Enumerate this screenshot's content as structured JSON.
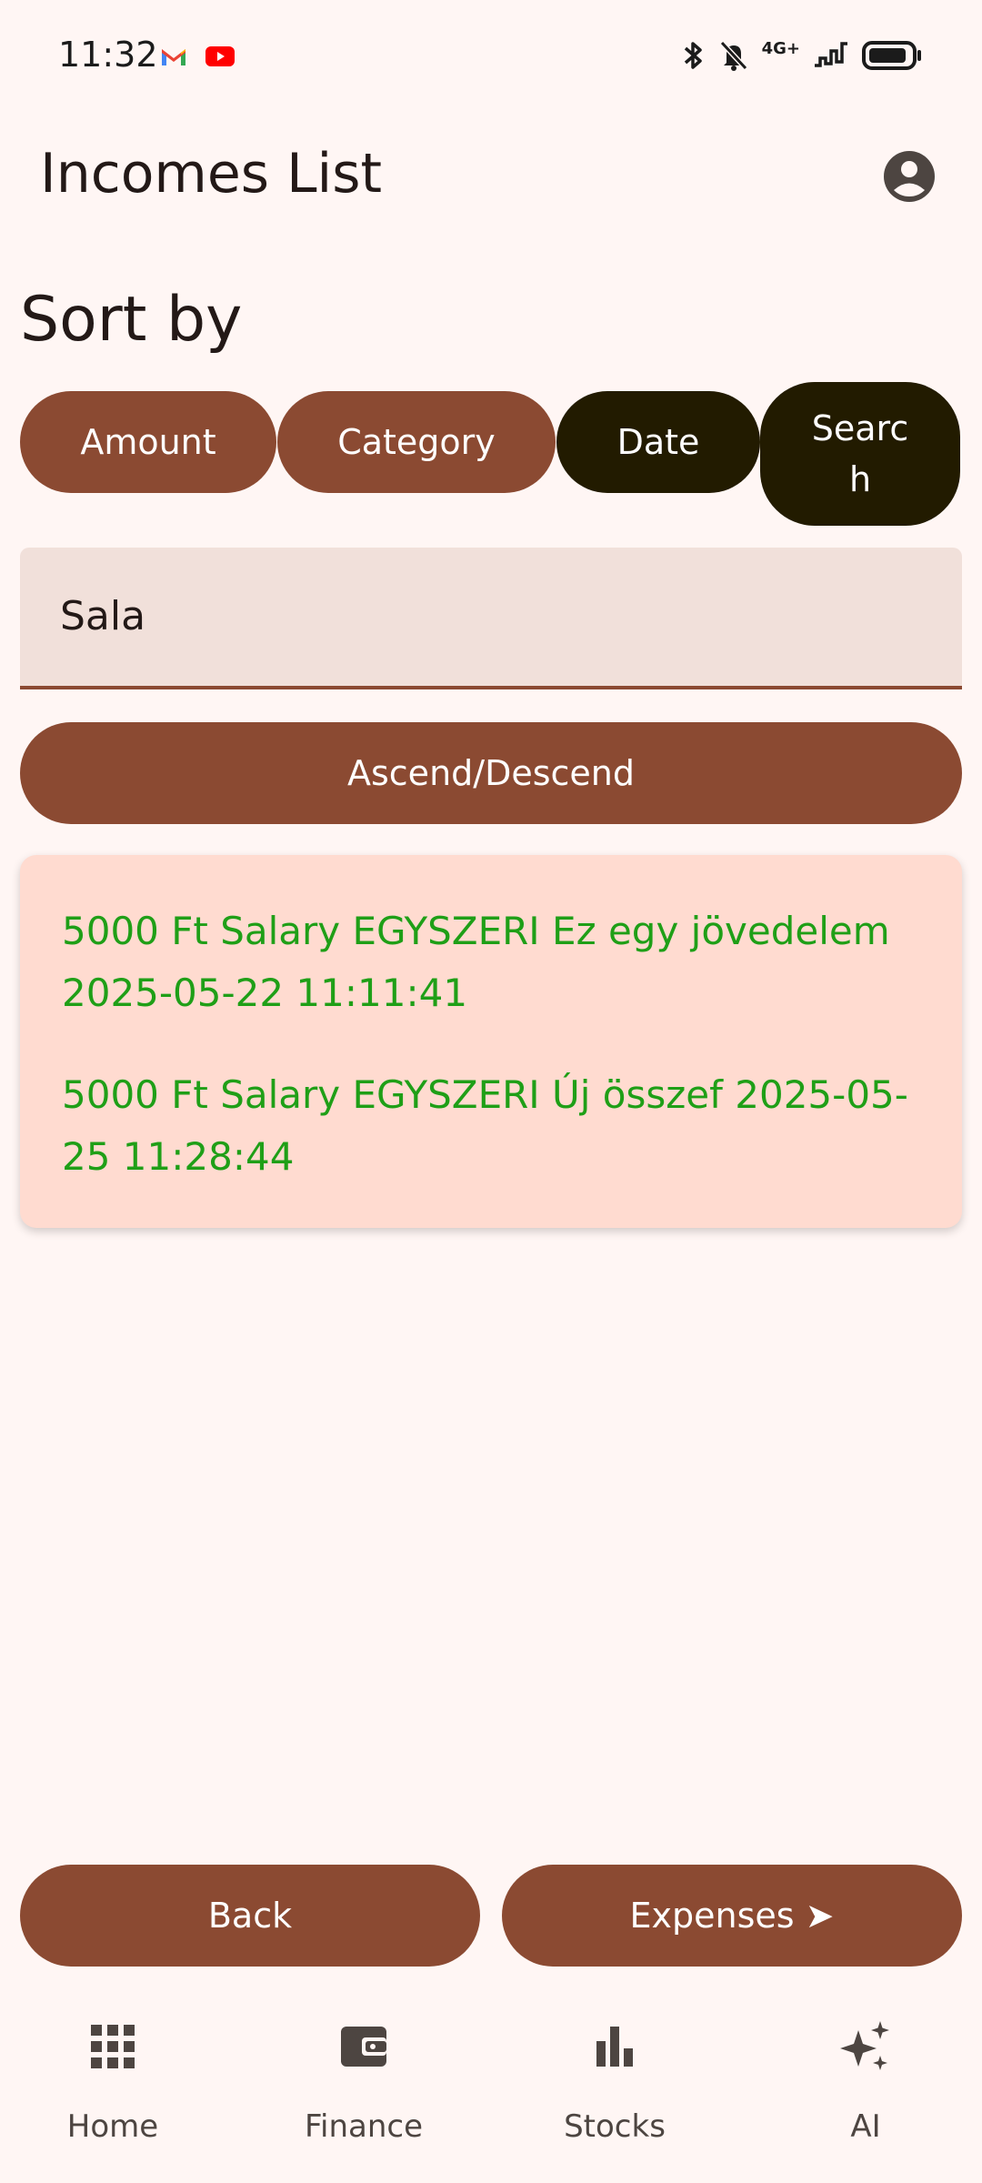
{
  "status_bar": {
    "time": "11:32",
    "notifications": [
      "gmail-icon",
      "youtube-icon"
    ],
    "network": "4G+",
    "system_icons": [
      "bluetooth-icon",
      "mute-icon",
      "signal-icon",
      "battery-icon"
    ]
  },
  "app_bar": {
    "title": "Incomes List",
    "account_icon": "account-circle-icon"
  },
  "sort": {
    "title": "Sort by",
    "options": [
      {
        "label": "Amount",
        "selected": false
      },
      {
        "label": "Category",
        "selected": false
      },
      {
        "label": "Date",
        "selected": true
      },
      {
        "label": "Search",
        "selected": true
      }
    ]
  },
  "search": {
    "value": "Sala"
  },
  "order_button": "Ascend/Descend",
  "incomes": [
    "5000 Ft Salary EGYSZERI Ez egy jövedelem 2025-05-22 11:11:41",
    "5000 Ft Salary EGYSZERI Új összef 2025-05-25 11:28:44"
  ],
  "actions": {
    "back": "Back",
    "expenses": "Expenses ➤"
  },
  "bottom_nav": [
    {
      "label": "Home",
      "icon": "apps-grid-icon"
    },
    {
      "label": "Finance",
      "icon": "wallet-icon"
    },
    {
      "label": "Stocks",
      "icon": "bar-chart-icon"
    },
    {
      "label": "AI",
      "icon": "sparkles-icon"
    }
  ],
  "colors": {
    "background": "#fff6f4",
    "primary": "#8b4a32",
    "selected_chip": "#221b00",
    "card": "#ffdbd0",
    "field": "#f1e0da",
    "income_text": "#1f9f17"
  }
}
